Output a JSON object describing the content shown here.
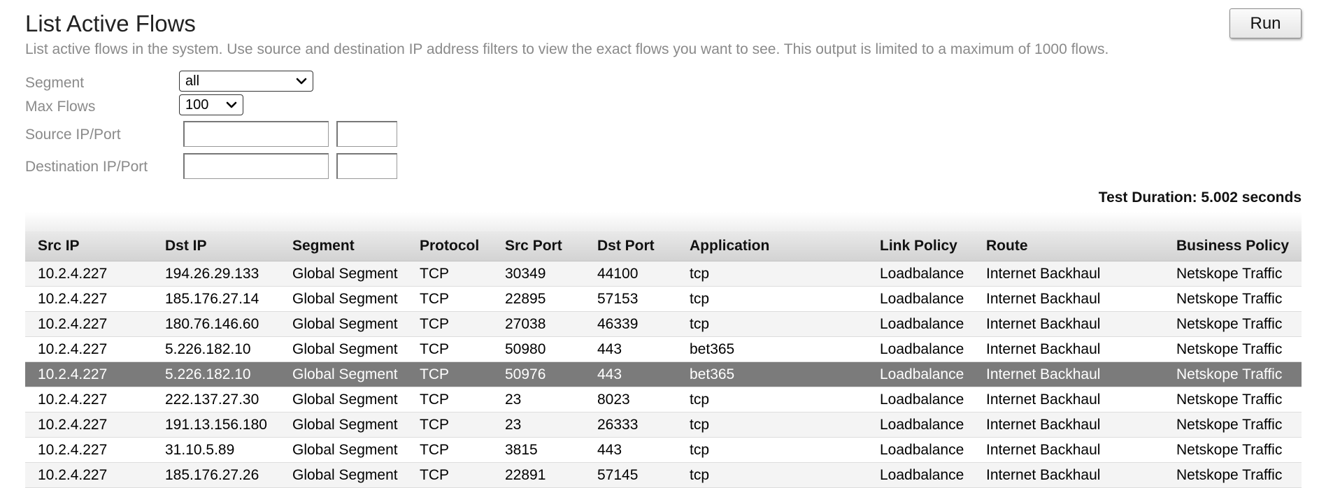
{
  "header": {
    "title": "List Active Flows",
    "description": "List active flows in the system. Use source and destination IP address filters to view the exact flows you want to see. This output is limited to a maximum of 1000 flows.",
    "run_label": "Run"
  },
  "form": {
    "segment_label": "Segment",
    "segment_value": "all",
    "max_flows_label": "Max Flows",
    "max_flows_value": "100",
    "source_label": "Source IP/Port",
    "destination_label": "Destination IP/Port",
    "source_ip_value": "",
    "source_port_value": "",
    "destination_ip_value": "",
    "destination_port_value": ""
  },
  "result": {
    "duration": "Test Duration: 5.002 seconds"
  },
  "table": {
    "columns": [
      "Src IP",
      "Dst IP",
      "Segment",
      "Protocol",
      "Src Port",
      "Dst Port",
      "Application",
      "Link Policy",
      "Route",
      "Business Policy"
    ],
    "selected_row_index": 4,
    "rows": [
      [
        "10.2.4.227",
        "194.26.29.133",
        "Global Segment",
        "TCP",
        "30349",
        "44100",
        "tcp",
        "Loadbalance",
        "Internet Backhaul",
        "Netskope Traffic"
      ],
      [
        "10.2.4.227",
        "185.176.27.14",
        "Global Segment",
        "TCP",
        "22895",
        "57153",
        "tcp",
        "Loadbalance",
        "Internet Backhaul",
        "Netskope Traffic"
      ],
      [
        "10.2.4.227",
        "180.76.146.60",
        "Global Segment",
        "TCP",
        "27038",
        "46339",
        "tcp",
        "Loadbalance",
        "Internet Backhaul",
        "Netskope Traffic"
      ],
      [
        "10.2.4.227",
        "5.226.182.10",
        "Global Segment",
        "TCP",
        "50980",
        "443",
        "bet365",
        "Loadbalance",
        "Internet Backhaul",
        "Netskope Traffic"
      ],
      [
        "10.2.4.227",
        "5.226.182.10",
        "Global Segment",
        "TCP",
        "50976",
        "443",
        "bet365",
        "Loadbalance",
        "Internet Backhaul",
        "Netskope Traffic"
      ],
      [
        "10.2.4.227",
        "222.137.27.30",
        "Global Segment",
        "TCP",
        "23",
        "8023",
        "tcp",
        "Loadbalance",
        "Internet Backhaul",
        "Netskope Traffic"
      ],
      [
        "10.2.4.227",
        "191.13.156.180",
        "Global Segment",
        "TCP",
        "23",
        "26333",
        "tcp",
        "Loadbalance",
        "Internet Backhaul",
        "Netskope Traffic"
      ],
      [
        "10.2.4.227",
        "31.10.5.89",
        "Global Segment",
        "TCP",
        "3815",
        "443",
        "tcp",
        "Loadbalance",
        "Internet Backhaul",
        "Netskope Traffic"
      ],
      [
        "10.2.4.227",
        "185.176.27.26",
        "Global Segment",
        "TCP",
        "22891",
        "57145",
        "tcp",
        "Loadbalance",
        "Internet Backhaul",
        "Netskope Traffic"
      ]
    ]
  }
}
